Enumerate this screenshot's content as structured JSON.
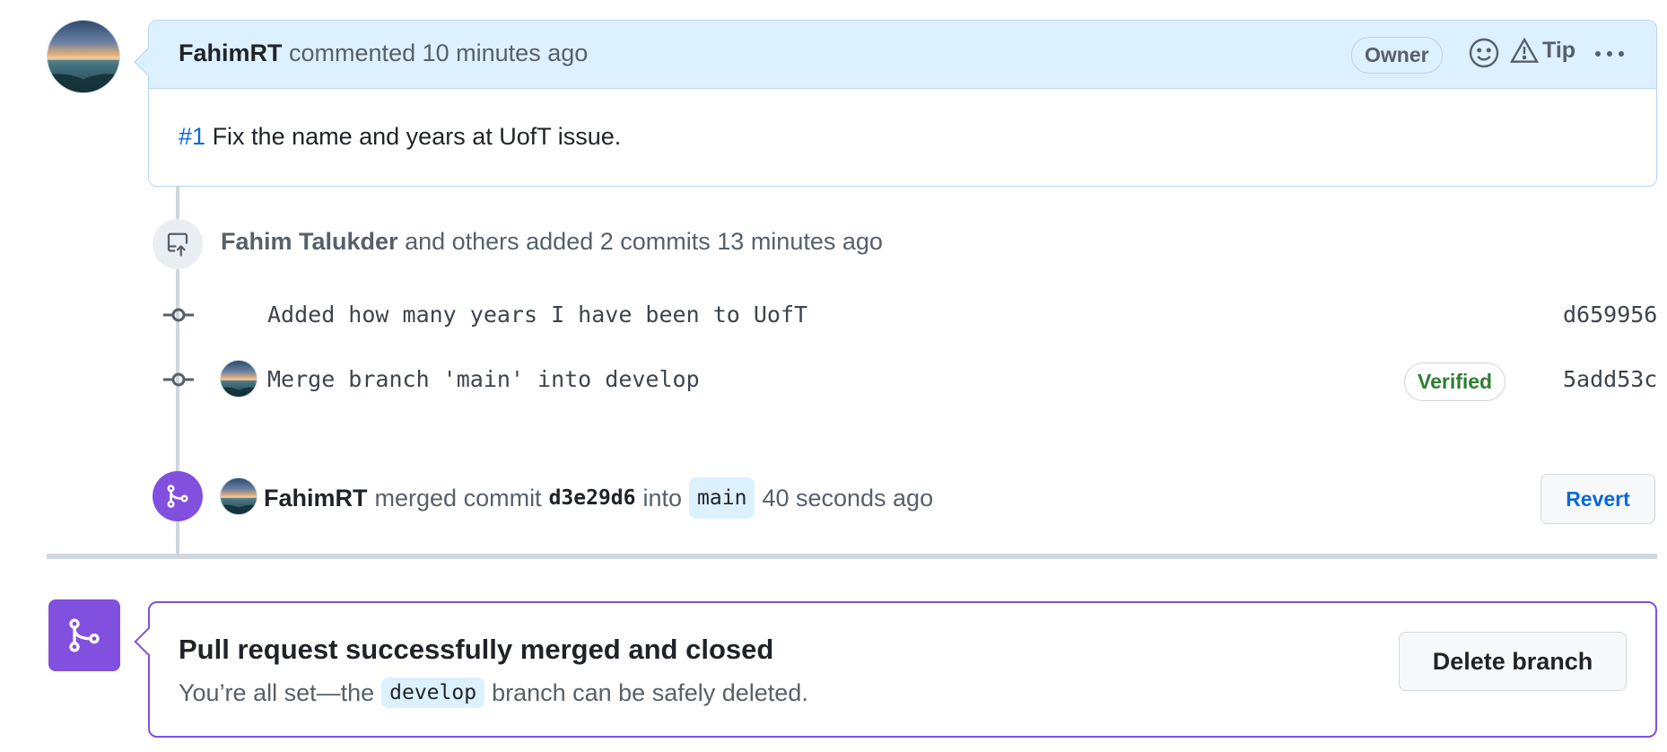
{
  "comment": {
    "author": "FahimRT",
    "action": "commented",
    "time": "10 minutes ago",
    "badge": "Owner",
    "tip_label": "Tip",
    "issue_ref": "#1",
    "body": "Fix the name and years at UofT issue."
  },
  "commits_event": {
    "author": "Fahim Talukder",
    "text": "and others added 2 commits",
    "time": "13 minutes ago",
    "commits": [
      {
        "message": "Added how many years I have been to UofT",
        "sha": "d659956",
        "verified": ""
      },
      {
        "message": "Merge branch 'main' into develop",
        "sha": "5add53c",
        "verified": "Verified"
      }
    ]
  },
  "merge_event": {
    "author": "FahimRT",
    "text1": "merged commit",
    "sha": "d3e29d6",
    "text2": "into",
    "branch": "main",
    "time": "40 seconds ago",
    "revert_label": "Revert"
  },
  "merged_banner": {
    "title": "Pull request successfully merged and closed",
    "desc_before": "You’re all set—the",
    "branch": "develop",
    "desc_after": "branch can be safely deleted.",
    "delete_label": "Delete branch"
  },
  "colors": {
    "accent_purple": "#8250df",
    "link_blue": "#0969da",
    "header_bg": "#ddf0fe",
    "verified_green": "#2f7d32"
  },
  "icons": [
    "smiley-icon",
    "alert-triangle-icon",
    "kebab-icon",
    "push-icon",
    "commit-icon",
    "merge-icon"
  ]
}
